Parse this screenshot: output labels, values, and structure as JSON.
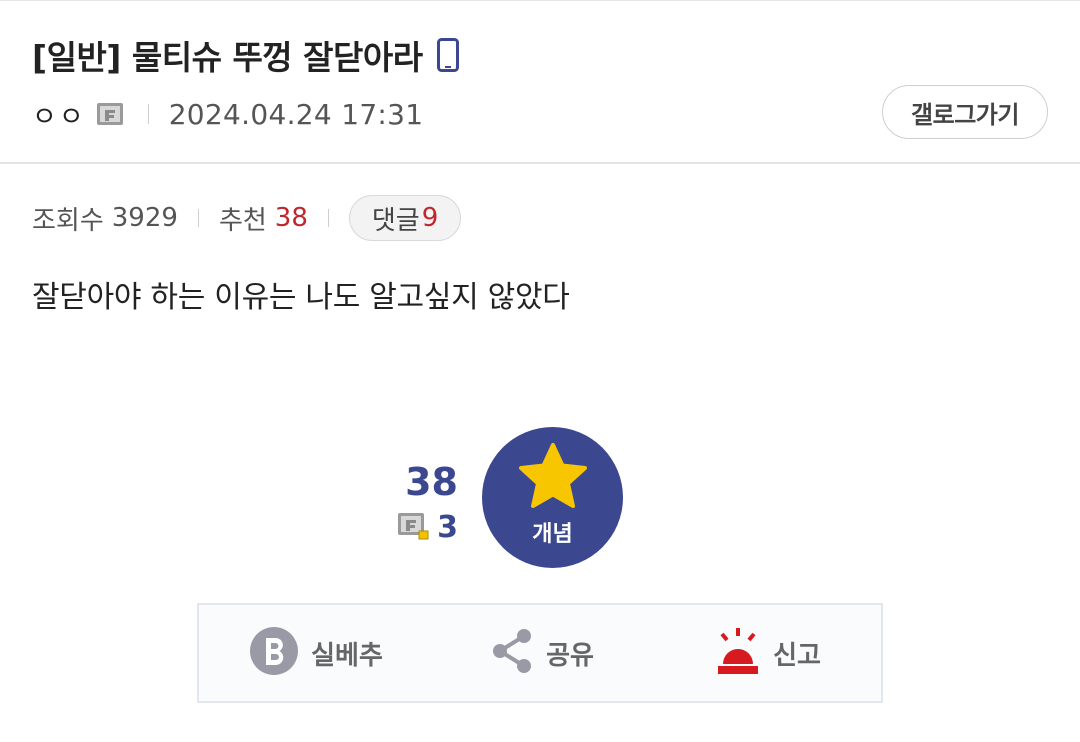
{
  "post": {
    "title": "[일반] 물티슈 뚜껑 잘닫아라",
    "author": "ㅇㅇ",
    "date": "2024.04.24 17:31",
    "body": "잘닫아야 하는 이유는 나도 알고싶지 않았다"
  },
  "header": {
    "gallery_button": "갤로그가기"
  },
  "stats": {
    "views_label": "조회수",
    "views": "3929",
    "recommend_label": "추천",
    "recommend": "38",
    "comments_label": "댓글",
    "comments": "9"
  },
  "recommend_box": {
    "count": "38",
    "fixed_count": "3",
    "concept_label": "개념"
  },
  "actions": {
    "silbe_label": "실베추",
    "share_label": "공유",
    "report_label": "신고"
  },
  "colors": {
    "accent_blue": "#3b4890",
    "highlight_red": "#c0272d",
    "star_yellow": "#f7c600",
    "report_red": "#d71920"
  },
  "icons": [
    "phone-icon",
    "fixed-user-icon",
    "star-icon",
    "silbe-b-icon",
    "share-icon",
    "siren-icon"
  ]
}
